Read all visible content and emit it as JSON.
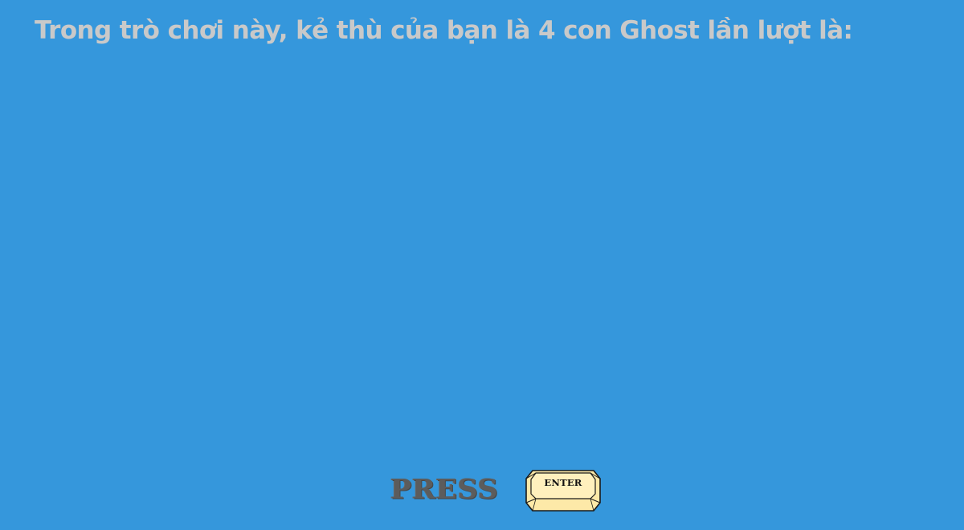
{
  "screen": {
    "intro_text": "Trong trò chơi này, kẻ thù của bạn là 4 con Ghost lần lượt là:"
  },
  "prompt": {
    "press_label": "PRESS",
    "enter_key_label": "ENTER"
  },
  "colors": {
    "background": "#3597dc",
    "intro_text": "#c9c9c9",
    "press_text": "#5c5c5c",
    "key_fill": "#fde9a8",
    "key_outline": "#1a1a1a"
  },
  "icons": {
    "enter_key": "keyboard-key-icon"
  }
}
